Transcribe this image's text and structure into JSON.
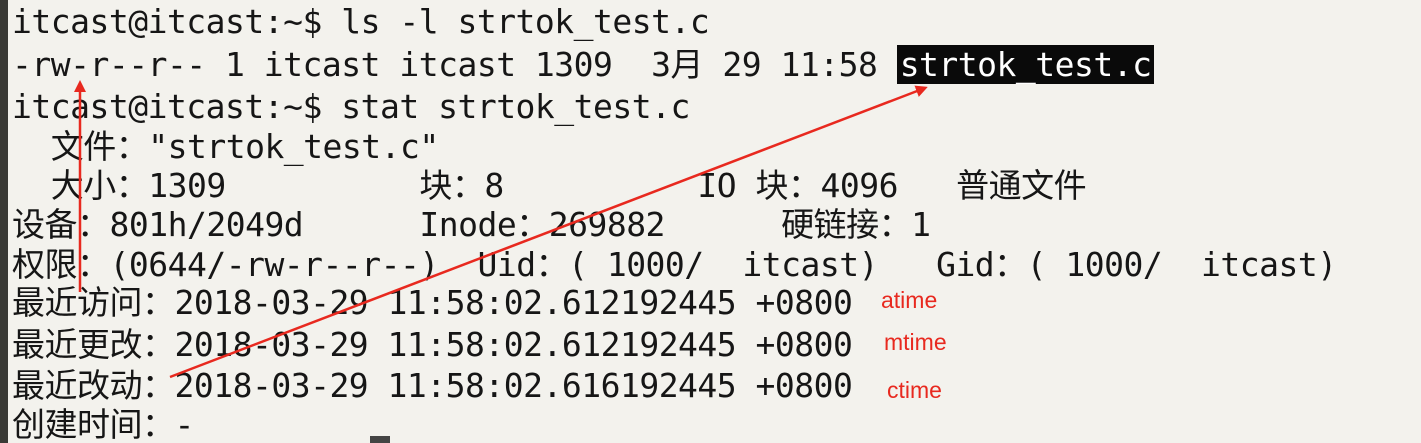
{
  "terminal": {
    "lines": {
      "cmd1": "itcast@itcast:~$ ls -l strtok_test.c",
      "ls_out_prefix": "-rw-r--r-- 1 itcast itcast 1309  3月 29 11:58 ",
      "ls_out_file": "strtok_test.c",
      "cmd2": "itcast@itcast:~$ stat strtok_test.c",
      "file": "  文件：\"strtok_test.c\"",
      "size": "  大小：1309          块：8          IO 块：4096   普通文件",
      "device": "设备：801h/2049d      Inode：269882      硬链接：1",
      "access": "权限：(0644/-rw-r--r--)  Uid：( 1000/  itcast)   Gid：( 1000/  itcast)",
      "atime": "最近访问：2018-03-29 11:58:02.612192445 +0800",
      "mtime": "最近更改：2018-03-29 11:58:02.612192445 +0800",
      "ctime": "最近改动：2018-03-29 11:58:02.616192445 +0800",
      "birth": "创建时间：-"
    }
  },
  "annotations": {
    "atime": "atime",
    "mtime": "mtime",
    "ctime": "ctime",
    "color": "#e8291f"
  }
}
